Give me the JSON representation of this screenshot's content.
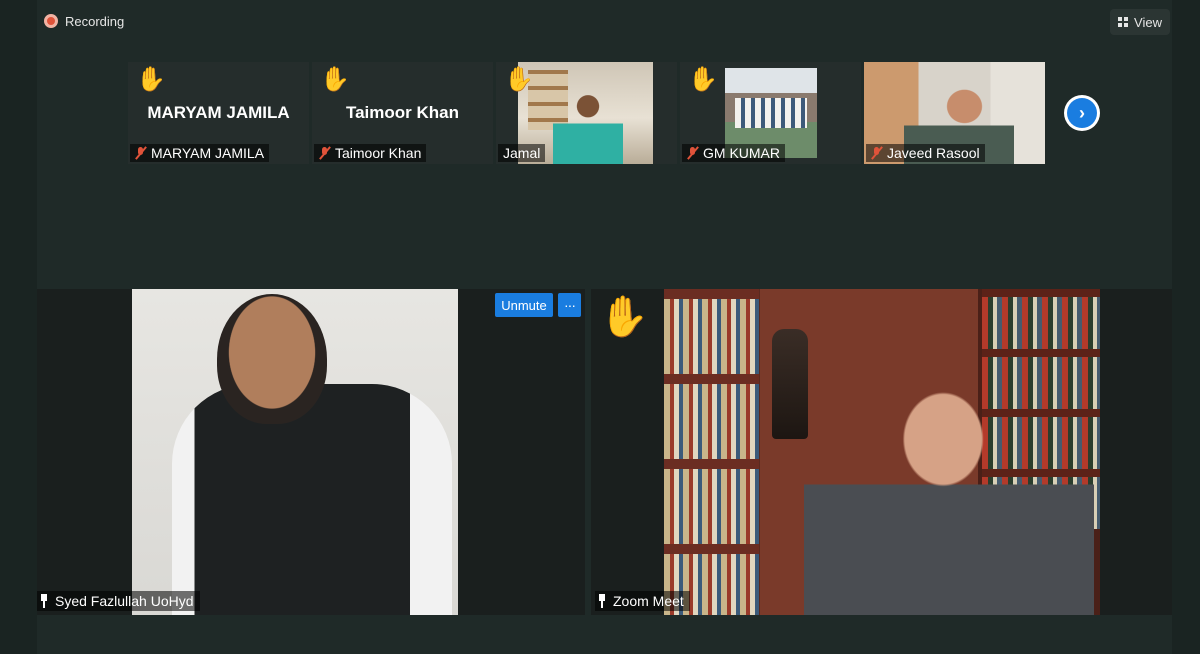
{
  "top_bar": {
    "recording_label": "Recording",
    "view_label": "View"
  },
  "strip": {
    "thumbs": [
      {
        "display_name": "MARYAM JAMILA",
        "label": "MARYAM JAMILA",
        "hand_raised": true,
        "muted": true,
        "video": false
      },
      {
        "display_name": "Taimoor Khan",
        "label": "Taimoor Khan",
        "hand_raised": true,
        "muted": true,
        "video": false
      },
      {
        "display_name": "",
        "label": "Jamal",
        "hand_raised": true,
        "muted": false,
        "video": true
      },
      {
        "display_name": "",
        "label": "GM KUMAR",
        "hand_raised": true,
        "muted": true,
        "video": true
      },
      {
        "display_name": "",
        "label": "Javeed Rasool",
        "hand_raised": false,
        "muted": true,
        "video": true
      }
    ],
    "next_icon": "chevron-right-icon"
  },
  "main": {
    "left_tile": {
      "name": "Syed Fazlullah UoHyd",
      "unmute_label": "Unmute",
      "more_label": "···"
    },
    "right_tile": {
      "name": "Zoom Meet",
      "hand_raised": true
    }
  },
  "colors": {
    "accent": "#1a7de0",
    "muted": "#e0533a",
    "hand": "#f5c342",
    "background": "#1f2a28"
  }
}
